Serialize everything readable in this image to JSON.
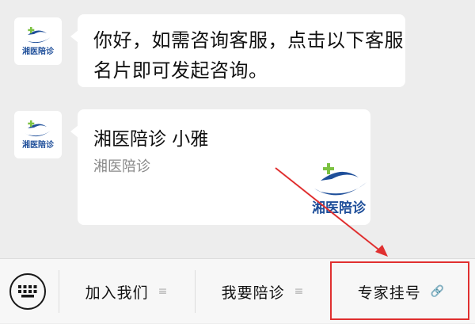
{
  "messages": [
    {
      "type": "text",
      "text": "你好，如需咨询客服，点击以下客服名片即可发起咨询。"
    },
    {
      "type": "card",
      "name": "湘医陪诊 小雅",
      "org": "湘医陪诊",
      "logo_text": "湘医陪诊"
    }
  ],
  "avatar": {
    "logo_text": "湘医陪诊",
    "brand_color": "#1f4f9a",
    "accent_color": "#7cc242"
  },
  "menu": {
    "items": [
      {
        "label": "加入我们",
        "mark": "≡"
      },
      {
        "label": "我要陪诊",
        "mark": "≡"
      },
      {
        "label": "专家挂号",
        "mark": "🔗"
      }
    ]
  },
  "annotation": {
    "highlight_color": "#e03030",
    "highlighted_item": "专家挂号"
  }
}
